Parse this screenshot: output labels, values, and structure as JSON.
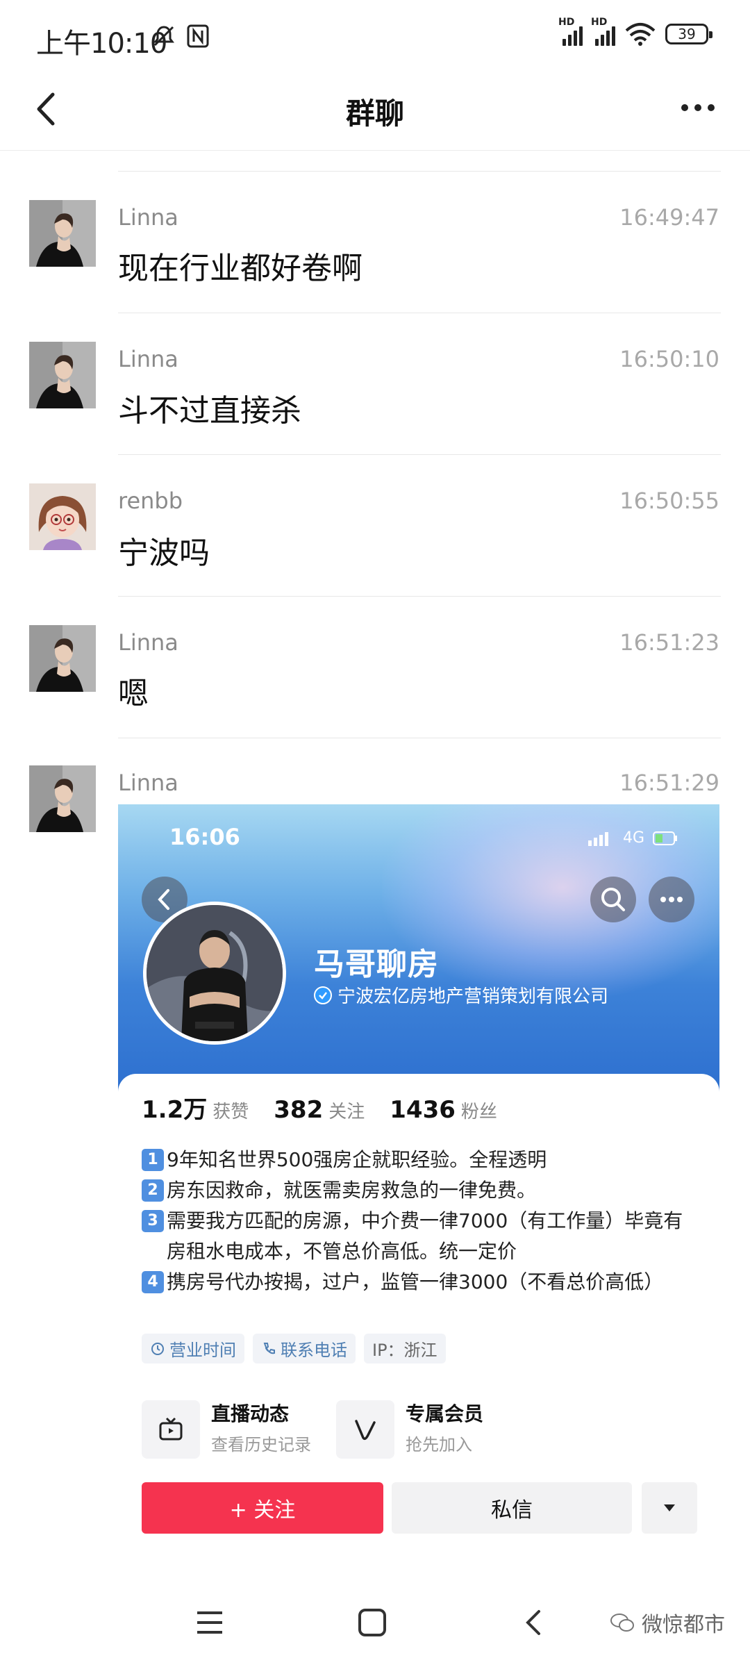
{
  "status_bar": {
    "time": "上午10:10",
    "hd_label": "HD",
    "battery": "39"
  },
  "header": {
    "title": "群聊"
  },
  "messages": [
    {
      "sender": "Linna",
      "time": "16:49:47",
      "text": "现在行业都好卷啊"
    },
    {
      "sender": "Linna",
      "time": "16:50:10",
      "text": "斗不过直接杀"
    },
    {
      "sender": "renbb",
      "time": "16:50:55",
      "text": "宁波吗"
    },
    {
      "sender": "Linna",
      "time": "16:51:23",
      "text": "嗯"
    },
    {
      "sender": "Linna",
      "time": "16:51:29",
      "text": ""
    }
  ],
  "shared_card": {
    "status_time": "16:06",
    "network": "4G",
    "name": "马哥聊房",
    "company": "宁波宏亿房地产营销策划有限公司",
    "stats": [
      {
        "value": "1.2万",
        "label": "获赞"
      },
      {
        "value": "382",
        "label": "关注"
      },
      {
        "value": "1436",
        "label": "粉丝"
      }
    ],
    "bio": [
      {
        "num": "1",
        "text": "9年知名世界500强房企就职经验。全程透明"
      },
      {
        "num": "2",
        "text": "房东因救命，就医需卖房救急的一律免费。"
      },
      {
        "num": "3",
        "text": "需要我方匹配的房源，中介费一律7000（有工作量）毕竟有房租水电成本，不管总价高低。统一定价"
      },
      {
        "num": "4",
        "text": "携房号代办按揭，过户，监管一律3000（不看总价高低）"
      }
    ],
    "tags": [
      "营业时间",
      "联系电话",
      "IP：浙江"
    ],
    "features": [
      {
        "title": "直播动态",
        "sub": "查看历史记录"
      },
      {
        "title": "专属会员",
        "sub": "抢先加入"
      }
    ],
    "follow_label": "+ 关注",
    "dm_label": "私信"
  },
  "watermark": "微惊都市"
}
